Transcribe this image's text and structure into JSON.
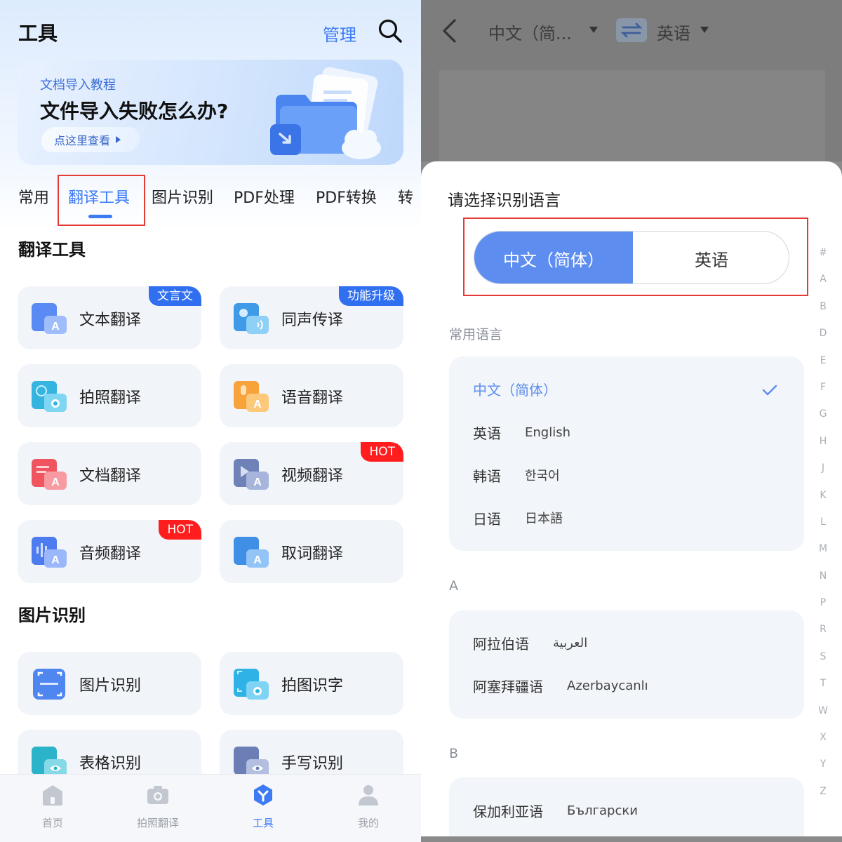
{
  "left": {
    "header": {
      "title": "工具",
      "manage": "管理"
    },
    "banner": {
      "subtitle": "文档导入教程",
      "title": "文件导入失败怎么办?",
      "button": "点这里查看"
    },
    "tabs": [
      "常用",
      "翻译工具",
      "图片识别",
      "PDF处理",
      "PDF转换",
      "转"
    ],
    "active_tab": "翻译工具",
    "sections": {
      "translate": {
        "title": "翻译工具",
        "cards": [
          {
            "label": "文本翻译",
            "badge": "文言文"
          },
          {
            "label": "同声传译",
            "badge": "功能升级"
          },
          {
            "label": "拍照翻译"
          },
          {
            "label": "语音翻译"
          },
          {
            "label": "文档翻译"
          },
          {
            "label": "视频翻译",
            "badge": "HOT"
          },
          {
            "label": "音频翻译",
            "badge": "HOT"
          },
          {
            "label": "取词翻译"
          }
        ]
      },
      "image": {
        "title": "图片识别",
        "cards": [
          {
            "label": "图片识别"
          },
          {
            "label": "拍图识字"
          },
          {
            "label": "表格识别"
          },
          {
            "label": "手写识别"
          }
        ]
      }
    },
    "bottom_nav": [
      {
        "label": "首页",
        "icon": "home-icon"
      },
      {
        "label": "拍照翻译",
        "icon": "camera-icon"
      },
      {
        "label": "工具",
        "icon": "tools-icon",
        "active": true
      },
      {
        "label": "我的",
        "icon": "user-icon"
      }
    ],
    "colors": {
      "accent": "#3d7bf5",
      "hot_badge": "#ff1d1d",
      "blue_badge": "#2f6ff0"
    }
  },
  "right": {
    "topbar": {
      "source_lang": "中文（简...",
      "target_lang": "英语"
    },
    "sheet": {
      "title": "请选择识别语言",
      "toggle": {
        "selected": "中文（简体）",
        "other": "英语"
      },
      "common_label": "常用语言",
      "common": [
        {
          "cn": "中文（简体）",
          "native": "",
          "selected": true
        },
        {
          "cn": "英语",
          "native": "English"
        },
        {
          "cn": "韩语",
          "native": "한국어"
        },
        {
          "cn": "日语",
          "native": "日本語"
        }
      ],
      "group_a_label": "A",
      "group_a": [
        {
          "cn": "阿拉伯语",
          "native": "العربية"
        },
        {
          "cn": "阿塞拜疆语",
          "native": "Azerbaycanlı"
        }
      ],
      "group_b_label": "B",
      "group_b": [
        {
          "cn": "保加利亚语",
          "native": "Български"
        }
      ],
      "alphabet": [
        "#",
        "A",
        "B",
        "D",
        "E",
        "F",
        "G",
        "H",
        "J",
        "K",
        "L",
        "M",
        "N",
        "P",
        "R",
        "S",
        "T",
        "W",
        "X",
        "Y",
        "Z"
      ]
    },
    "colors": {
      "selected": "#5e8df0",
      "highlight_box": "#e53935"
    }
  }
}
